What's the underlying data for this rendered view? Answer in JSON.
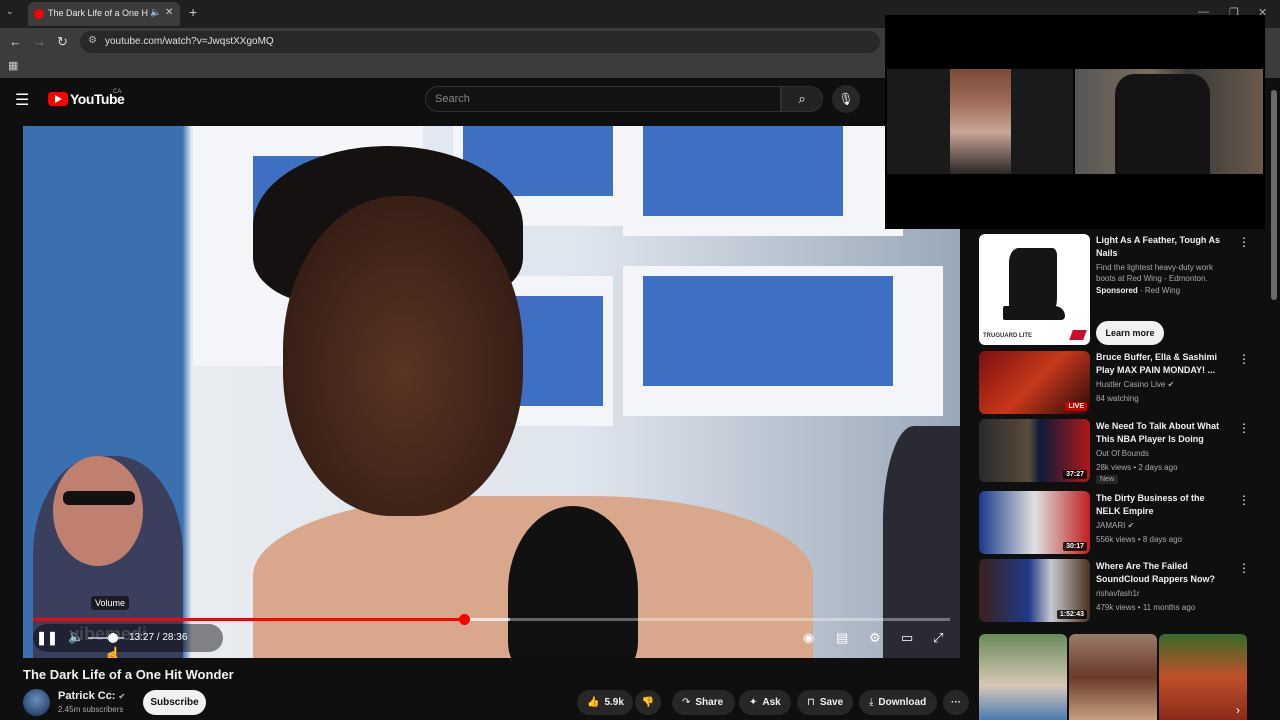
{
  "browser": {
    "tab_title": "The Dark Life of a One Hit W",
    "tab_list_icon": "⌄",
    "tab_mute": "🔈",
    "tab_close": "✕",
    "new_tab": "+",
    "url": "youtube.com/watch?v=JwqstXXgoMQ",
    "apps_icon": "▦"
  },
  "youtube": {
    "logo_text": "YouTube",
    "country_code": "CA",
    "search_placeholder": "Search"
  },
  "player": {
    "current_time": "13:27",
    "duration": "28:36",
    "time_text": "13:27 / 28:36",
    "progress_fraction": 0.47,
    "buffer_fraction": 0.52,
    "volume_fraction": 0.7,
    "volume_tooltip": "Volume",
    "watermark": "vibemedi",
    "accent_color": "#ff0000"
  },
  "video": {
    "title": "The Dark Life of a One Hit Wonder",
    "channel_name": "Patrick Cc:",
    "channel_verified": "✔",
    "subscribers": "2.45m subscribers",
    "subscribe_label": "Subscribe",
    "likes": "5.9k",
    "share_label": "Share",
    "ask_label": "Ask",
    "save_label": "Save",
    "download_label": "Download",
    "more_label": "···"
  },
  "sidebar": {
    "ad": {
      "title": "Light As A Feather, Tough As Nails",
      "desc": "Find the lightest heavy-duty work boots at Red Wing - Edmonton.",
      "sponsored": "Sponsored",
      "advertiser": "Red Wing",
      "thumb_label": "TRUGUARD LITE",
      "cta": "Learn more"
    },
    "videos": [
      {
        "title": "Bruce Buffer, Ella & Sashimi Play MAX PAIN MONDAY! ...",
        "channel": "Hustler Casino Live ✔",
        "meta": "84 watching",
        "badge": "LIVE"
      },
      {
        "title": "We Need To Talk About What This NBA Player Is Doing",
        "channel": "Out Of Bounds",
        "meta": "28k views • 2 days ago",
        "badge": "37:27",
        "new": "New"
      },
      {
        "title": "The Dirty Business of the NELK Empire",
        "channel": "JAMARI ✔",
        "meta": "556k views • 8 days ago",
        "badge": "30:17"
      },
      {
        "title": "Where Are The Failed SoundCloud Rappers Now?",
        "channel": "rishavfash1r",
        "meta": "479k views • 11 months ago",
        "badge": "1:52:43"
      }
    ]
  }
}
